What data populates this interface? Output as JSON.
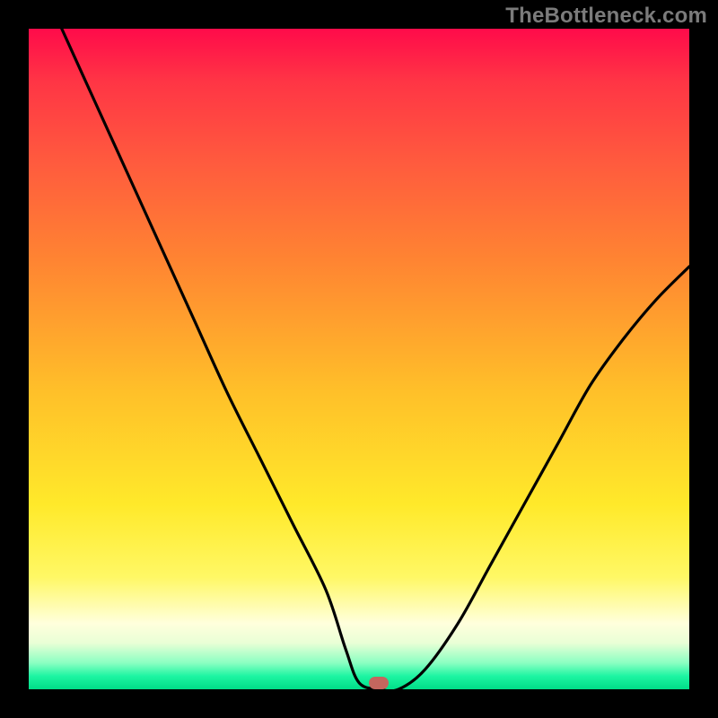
{
  "watermark": "TheBottleneck.com",
  "marker": {
    "x_pct": 53,
    "y_pct": 99.0
  },
  "chart_data": {
    "type": "line",
    "title": "",
    "xlabel": "",
    "ylabel": "",
    "xlim": [
      0,
      100
    ],
    "ylim": [
      0,
      100
    ],
    "grid": false,
    "series": [
      {
        "name": "bottleneck-curve",
        "x": [
          5,
          10,
          15,
          20,
          25,
          30,
          35,
          40,
          45,
          48,
          50,
          53,
          56,
          60,
          65,
          70,
          75,
          80,
          85,
          90,
          95,
          100
        ],
        "y": [
          100,
          89,
          78,
          67,
          56,
          45,
          35,
          25,
          15,
          6,
          1,
          0,
          0,
          3,
          10,
          19,
          28,
          37,
          46,
          53,
          59,
          64
        ],
        "note": "x and y are percentages of the plot area; y=0 at bottom. Minimum (optimum) at x≈53%. Curve rises steeply to left edge (~100% at x≈5%) and moderately to right (~64% at x=100%)."
      }
    ],
    "optimum_marker": {
      "x_pct": 53,
      "y_pct": 0
    },
    "gradient_stops": [
      {
        "pct": 0,
        "color": "#ff0b4a"
      },
      {
        "pct": 8,
        "color": "#ff3545"
      },
      {
        "pct": 20,
        "color": "#ff5a3e"
      },
      {
        "pct": 35,
        "color": "#ff8432"
      },
      {
        "pct": 55,
        "color": "#ffc029"
      },
      {
        "pct": 72,
        "color": "#ffe92a"
      },
      {
        "pct": 83,
        "color": "#fff865"
      },
      {
        "pct": 90,
        "color": "#ffffdc"
      },
      {
        "pct": 93,
        "color": "#e9ffd6"
      },
      {
        "pct": 96,
        "color": "#8bffc2"
      },
      {
        "pct": 98,
        "color": "#1df5a2"
      },
      {
        "pct": 100,
        "color": "#00dd88"
      }
    ]
  }
}
